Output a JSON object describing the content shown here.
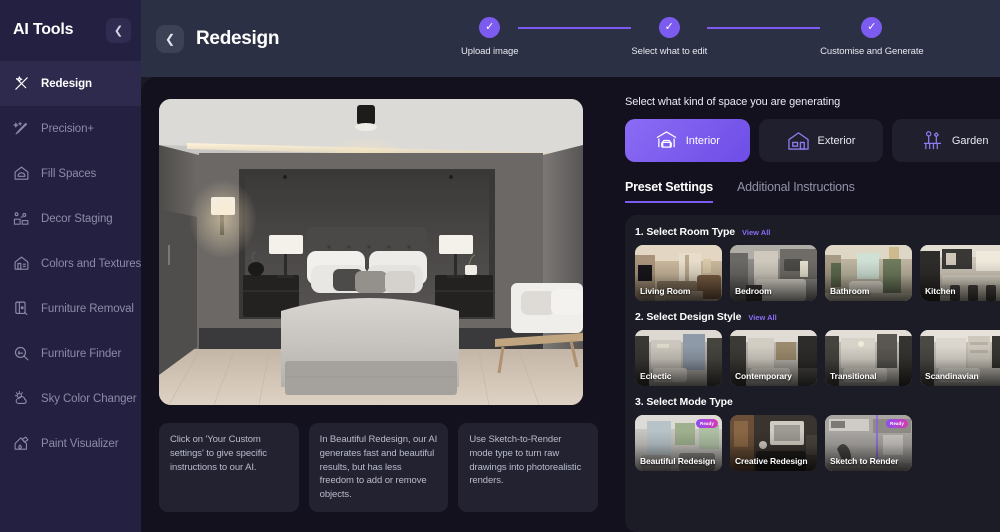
{
  "sidebar": {
    "title": "AI Tools",
    "collapse_icon": "chevron-left-icon",
    "items": [
      {
        "label": "Redesign",
        "icon": "magic-wand-icon",
        "active": true
      },
      {
        "label": "Precision+",
        "icon": "precision-brush-icon",
        "active": false
      },
      {
        "label": "Fill Spaces",
        "icon": "house-fill-icon",
        "active": false
      },
      {
        "label": "Decor Staging",
        "icon": "decor-staging-icon",
        "active": false
      },
      {
        "label": "Colors and Textures",
        "icon": "house-texture-icon",
        "active": false
      },
      {
        "label": "Furniture Removal",
        "icon": "furniture-removal-icon",
        "active": false
      },
      {
        "label": "Furniture Finder",
        "icon": "magnifier-icon",
        "active": false
      },
      {
        "label": "Sky Color Changer",
        "icon": "sun-cloud-icon",
        "active": false
      },
      {
        "label": "Paint Visualizer",
        "icon": "paint-roller-icon",
        "active": false
      }
    ]
  },
  "topbar": {
    "back_icon": "chevron-left-icon",
    "title": "Redesign",
    "steps": [
      {
        "label": "Upload image",
        "state": "complete",
        "check": "✓"
      },
      {
        "label": "Select what to edit",
        "state": "complete",
        "check": "✓"
      },
      {
        "label": "Customise and Generate",
        "state": "complete",
        "check": "✓"
      }
    ]
  },
  "workspace": {
    "preview_alt": "bedroom-interior-preview",
    "tips": [
      "Click on 'Your Custom settings' to give specific instructions to our AI.",
      "In Beautiful Redesign, our AI generates fast and beautiful results, but has less freedom to add or remove objects.",
      "Use Sketch-to-Render mode type to turn raw drawings into photorealistic renders."
    ]
  },
  "panel": {
    "heading": "Select what kind of space you are generating",
    "space_types": [
      {
        "label": "Interior",
        "icon": "interior-sofa-icon",
        "active": true
      },
      {
        "label": "Exterior",
        "icon": "exterior-house-icon",
        "active": false
      },
      {
        "label": "Garden",
        "icon": "garden-flowers-icon",
        "active": false
      }
    ],
    "tabs": [
      {
        "label": "Preset Settings",
        "active": true
      },
      {
        "label": "Additional Instructions",
        "active": false
      }
    ],
    "view_all_label": "View All",
    "sections": [
      {
        "title": "1. Select Room Type",
        "has_view_all": true,
        "items": [
          {
            "label": "Living Room"
          },
          {
            "label": "Bedroom"
          },
          {
            "label": "Bathroom"
          },
          {
            "label": "Kitchen"
          }
        ]
      },
      {
        "title": "2. Select Design Style",
        "has_view_all": true,
        "items": [
          {
            "label": "Eclectic"
          },
          {
            "label": "Contemporary"
          },
          {
            "label": "Transitional"
          },
          {
            "label": "Scandinavian"
          }
        ]
      },
      {
        "title": "3. Select Mode Type",
        "has_view_all": false,
        "items": [
          {
            "label": "Beautiful Redesign",
            "badge": "Ready"
          },
          {
            "label": "Creative Redesign",
            "badge": ""
          },
          {
            "label": "Sketch to Render",
            "badge": "Ready"
          }
        ]
      }
    ]
  },
  "colors": {
    "accent": "#7c5cf0",
    "sidebar_bg": "#242041",
    "topbar_bg": "#2c3044",
    "body_bg": "#14111f",
    "card_bg": "#1c1c27"
  }
}
